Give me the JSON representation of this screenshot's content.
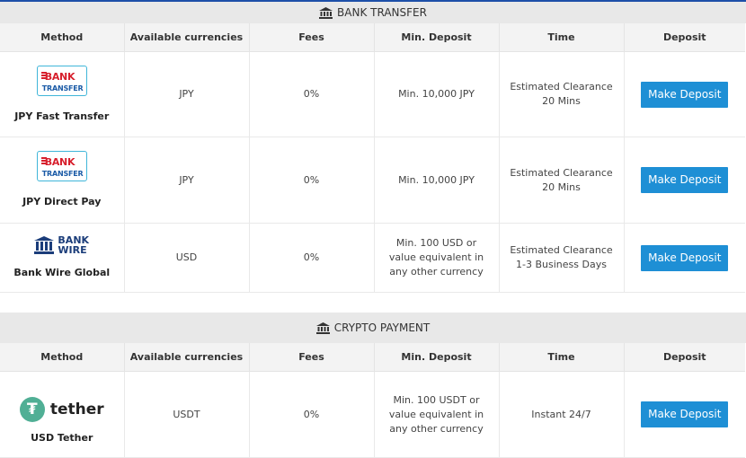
{
  "bank_section": {
    "title": "BANK TRANSFER",
    "headers": [
      "Method",
      "Available currencies",
      "Fees",
      "Min. Deposit",
      "Time",
      "Deposit"
    ],
    "rows": [
      {
        "method": "JPY Fast Transfer",
        "logo_line1": "BANK",
        "logo_line2": "TRANSFER",
        "currency": "JPY",
        "fees": "0%",
        "min_deposit": "Min. 10,000 JPY",
        "time": "Estimated Clearance 20 Mins",
        "button": "Make Deposit"
      },
      {
        "method": "JPY Direct Pay",
        "logo_line1": "BANK",
        "logo_line2": "TRANSFER",
        "currency": "JPY",
        "fees": "0%",
        "min_deposit": "Min. 10,000 JPY",
        "time": "Estimated Clearance 20 Mins",
        "button": "Make Deposit"
      },
      {
        "method": "Bank Wire Global",
        "logo_line1": "BANK",
        "logo_line2": "WIRE",
        "currency": "USD",
        "fees": "0%",
        "min_deposit": "Min. 100 USD or value equivalent in any other currency",
        "time": "Estimated Clearance 1-3 Business Days",
        "button": "Make Deposit"
      }
    ]
  },
  "crypto_section": {
    "title": "CRYPTO PAYMENT",
    "headers": [
      "Method",
      "Available currencies",
      "Fees",
      "Min. Deposit",
      "Time",
      "Deposit"
    ],
    "rows": [
      {
        "method": "USD Tether",
        "logo_text": "tether",
        "logo_symbol": "₮",
        "currency": "USDT",
        "fees": "0%",
        "min_deposit": "Min. 100 USDT or value equivalent in any other currency",
        "time": "Instant 24/7",
        "button": "Make Deposit"
      }
    ]
  },
  "colors": {
    "button": "#1e8fd5",
    "header_bg": "#e8e8e8",
    "tether_green": "#50af95",
    "bank_red": "#d71f2c",
    "bank_blue": "#1a5aa6"
  }
}
